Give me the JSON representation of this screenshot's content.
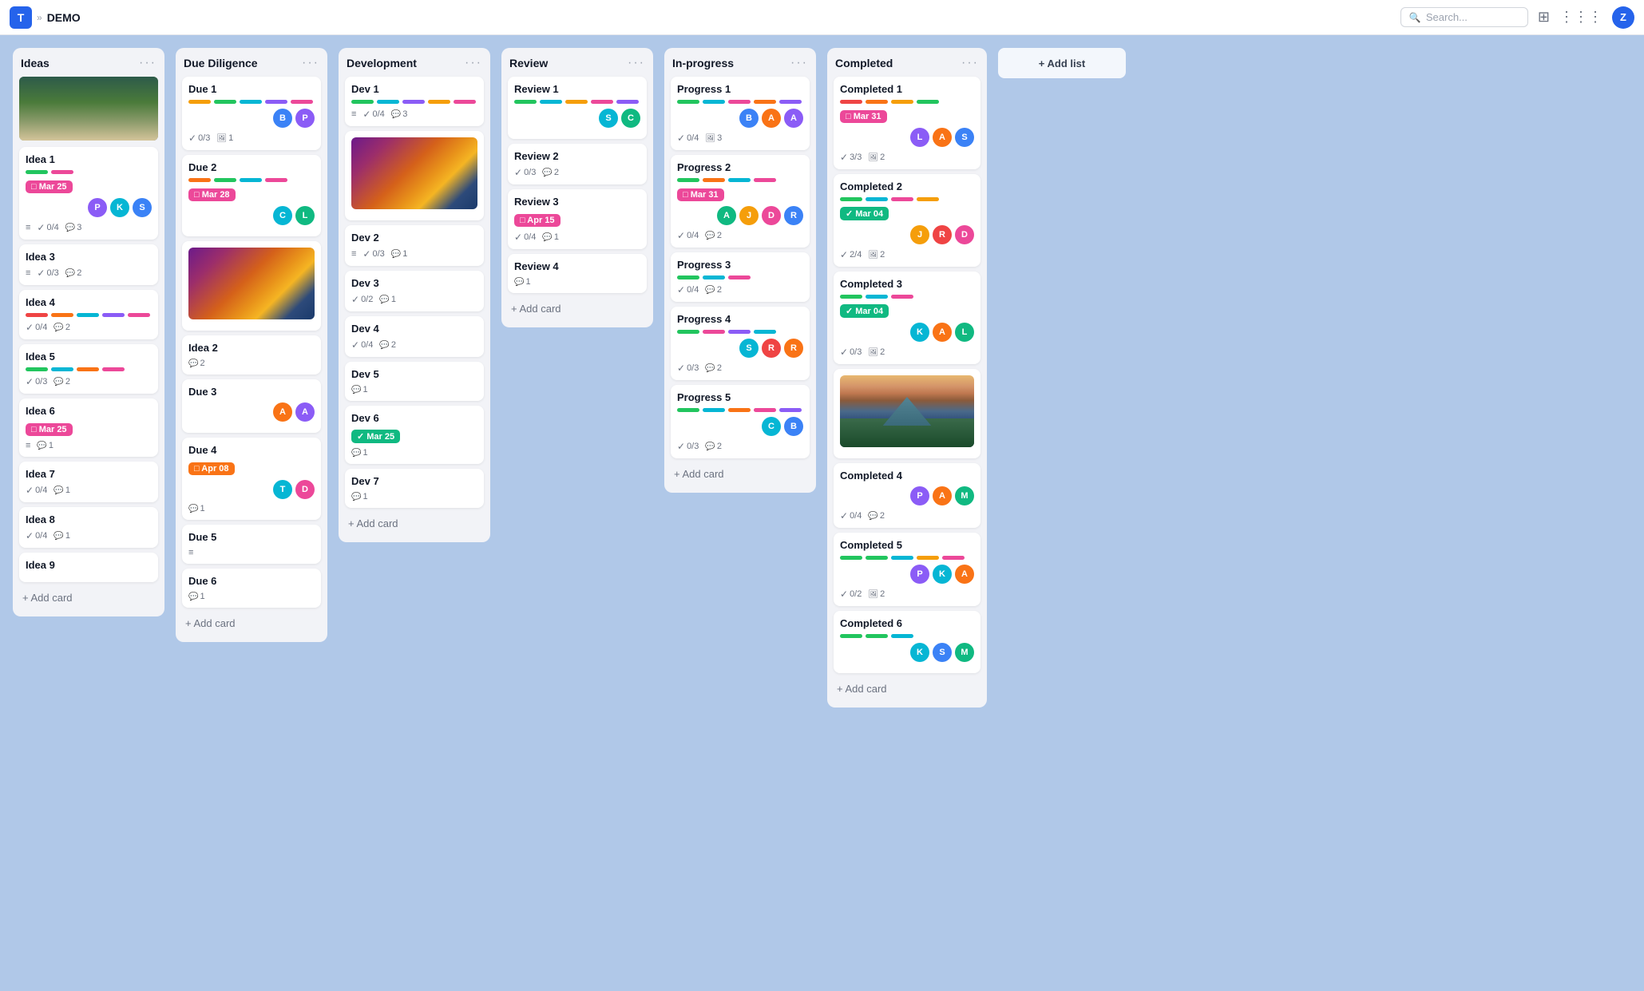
{
  "topbar": {
    "logo": "T",
    "breadcrumb": "»",
    "title": "DEMO",
    "search_placeholder": "Search...",
    "avatar": "Z"
  },
  "columns": [
    {
      "id": "ideas",
      "title": "Ideas",
      "has_image": true,
      "cards": [
        {
          "id": "idea1",
          "title": "Idea 1",
          "tags": [
            "#22c55e",
            "#ec4899"
          ],
          "date": {
            "label": "Mar 25",
            "type": "pink"
          },
          "avatars": [
            {
              "label": "P",
              "color": "#8b5cf6"
            },
            {
              "label": "K",
              "color": "#06b6d4"
            },
            {
              "label": "S",
              "color": "#3b82f6"
            }
          ],
          "footer": {
            "list": true,
            "check": "0/4",
            "msg": "3"
          }
        },
        {
          "id": "idea3",
          "title": "Idea 3",
          "tags": [],
          "footer": {
            "list": true,
            "check": "0/3",
            "msg": "2"
          }
        },
        {
          "id": "idea4",
          "title": "Idea 4",
          "tags": [
            "#ef4444",
            "#f97316",
            "#06b6d4",
            "#8b5cf6",
            "#ec4899"
          ],
          "footer": {
            "list": false,
            "check": "0/4",
            "msg": "2"
          }
        },
        {
          "id": "idea5",
          "title": "Idea 5",
          "tags": [
            "#22c55e",
            "#06b6d4",
            "#f97316",
            "#ec4899"
          ],
          "footer": {
            "list": false,
            "check": "0/3",
            "msg": "2"
          }
        },
        {
          "id": "idea6",
          "title": "Idea 6",
          "date": {
            "label": "Mar 25",
            "type": "pink"
          },
          "footer": {
            "list": true,
            "msg": "1"
          }
        },
        {
          "id": "idea7",
          "title": "Idea 7",
          "footer": {
            "list": false,
            "check": "0/4",
            "msg": "1"
          }
        },
        {
          "id": "idea8",
          "title": "Idea 8",
          "footer": {
            "list": false,
            "check": "0/4",
            "msg": "1"
          }
        },
        {
          "id": "idea9",
          "title": "Idea 9",
          "footer": {}
        }
      ],
      "add_card": "+ Add card"
    },
    {
      "id": "due",
      "title": "Due Diligence",
      "cards": [
        {
          "id": "due1",
          "title": "Due 1",
          "tags": [
            "#f59e0b",
            "#22c55e",
            "#06b6d4",
            "#8b5cf6",
            "#ec4899"
          ],
          "avatars": [
            {
              "label": "B",
              "color": "#3b82f6"
            },
            {
              "label": "P",
              "color": "#8b5cf6"
            }
          ],
          "footer": {
            "list": false,
            "check": "0/3",
            "img": "1"
          }
        },
        {
          "id": "due2",
          "title": "Due 2",
          "tags": [
            "#f97316",
            "#22c55e",
            "#06b6d4",
            "#ec4899"
          ],
          "date": {
            "label": "Mar 28",
            "type": "pink"
          },
          "avatars": [
            {
              "label": "C",
              "color": "#06b6d4"
            },
            {
              "label": "L",
              "color": "#10b981"
            }
          ],
          "footer": {}
        },
        {
          "id": "idea2-img",
          "title": "",
          "has_thumbnail": "sunset",
          "footer": {}
        },
        {
          "id": "idea2",
          "title": "Idea 2",
          "footer": {
            "msg": "2"
          }
        },
        {
          "id": "due3",
          "title": "Due 3",
          "tags": [],
          "avatars": [
            {
              "label": "A",
              "color": "#f97316"
            },
            {
              "label": "A",
              "color": "#8b5cf6"
            }
          ],
          "footer": {}
        },
        {
          "id": "due4",
          "title": "Due 4",
          "date": {
            "label": "Apr 08",
            "type": "orange"
          },
          "avatars": [
            {
              "label": "T",
              "color": "#06b6d4"
            },
            {
              "label": "D",
              "color": "#ec4899"
            }
          ],
          "footer": {
            "msg": "1"
          }
        },
        {
          "id": "due5",
          "title": "Due 5",
          "footer": {
            "list": true
          }
        },
        {
          "id": "due6",
          "title": "Due 6",
          "footer": {
            "list": false,
            "msg": "1"
          }
        }
      ],
      "add_card": "+ Add card"
    },
    {
      "id": "dev",
      "title": "Development",
      "cards": [
        {
          "id": "dev1",
          "title": "Dev 1",
          "tags": [
            "#22c55e",
            "#06b6d4",
            "#8b5cf6",
            "#f59e0b",
            "#ec4899"
          ],
          "footer": {
            "list": true,
            "check": "0/4",
            "msg": "3"
          }
        },
        {
          "id": "dev1-img",
          "has_thumbnail": "sunset2",
          "footer": {}
        },
        {
          "id": "dev2",
          "title": "Dev 2",
          "footer": {
            "list": true,
            "check": "0/3",
            "msg": "1"
          }
        },
        {
          "id": "dev3",
          "title": "Dev 3",
          "footer": {
            "list": false,
            "check": "0/2",
            "msg": "1"
          }
        },
        {
          "id": "dev4",
          "title": "Dev 4",
          "footer": {
            "list": false,
            "check": "0/4",
            "msg": "2"
          }
        },
        {
          "id": "dev5",
          "title": "Dev 5",
          "footer": {
            "list": false,
            "msg": "1"
          }
        },
        {
          "id": "dev6",
          "title": "Dev 6",
          "date": {
            "label": "Mar 25",
            "type": "green"
          },
          "footer": {
            "list": false,
            "msg": "1"
          }
        },
        {
          "id": "dev7",
          "title": "Dev 7",
          "footer": {
            "list": false,
            "msg": "1"
          }
        }
      ],
      "add_card": "+ Add card"
    },
    {
      "id": "review",
      "title": "Review",
      "cards": [
        {
          "id": "rev1",
          "title": "Review 1",
          "tags": [
            "#22c55e",
            "#06b6d4",
            "#f59e0b",
            "#ec4899",
            "#8b5cf6"
          ],
          "avatars": [
            {
              "label": "S",
              "color": "#06b6d4"
            },
            {
              "label": "C",
              "color": "#10b981"
            }
          ],
          "footer": {}
        },
        {
          "id": "rev2",
          "title": "Review 2",
          "footer": {
            "list": false,
            "check": "0/3",
            "msg": "2"
          }
        },
        {
          "id": "rev3",
          "title": "Review 3",
          "date": {
            "label": "Apr 15",
            "type": "pink"
          },
          "footer": {
            "list": false,
            "check": "0/4",
            "msg": "1"
          }
        },
        {
          "id": "rev4",
          "title": "Review 4",
          "footer": {
            "list": false,
            "msg": "1"
          }
        }
      ],
      "add_card": "+ Add card"
    },
    {
      "id": "inprogress",
      "title": "In-progress",
      "cards": [
        {
          "id": "prog1",
          "title": "Progress 1",
          "tags": [
            "#22c55e",
            "#06b6d4",
            "#ec4899",
            "#f97316",
            "#8b5cf6"
          ],
          "avatars": [
            {
              "label": "B",
              "color": "#3b82f6"
            },
            {
              "label": "A",
              "color": "#f97316"
            },
            {
              "label": "A",
              "color": "#8b5cf6"
            }
          ],
          "footer": {
            "list": false,
            "check": "0/4",
            "img": "3"
          }
        },
        {
          "id": "prog2",
          "title": "Progress 2",
          "tags": [
            "#22c55e",
            "#f97316",
            "#06b6d4",
            "#ec4899"
          ],
          "date": {
            "label": "Mar 31",
            "type": "pink"
          },
          "avatars": [
            {
              "label": "A",
              "color": "#10b981"
            },
            {
              "label": "J",
              "color": "#f59e0b"
            },
            {
              "label": "D",
              "color": "#ec4899"
            },
            {
              "label": "R",
              "color": "#3b82f6"
            }
          ],
          "footer": {
            "list": false,
            "check": "0/4",
            "msg": "2"
          }
        },
        {
          "id": "prog3",
          "title": "Progress 3",
          "tags": [
            "#22c55e",
            "#06b6d4",
            "#ec4899"
          ],
          "footer": {
            "list": false,
            "check": "0/4",
            "msg": "2"
          }
        },
        {
          "id": "prog4",
          "title": "Progress 4",
          "tags": [
            "#22c55e",
            "#ec4899",
            "#8b5cf6",
            "#06b6d4"
          ],
          "avatars": [
            {
              "label": "S",
              "color": "#06b6d4"
            },
            {
              "label": "R",
              "color": "#ef4444"
            },
            {
              "label": "R",
              "color": "#f97316"
            }
          ],
          "footer": {
            "list": false,
            "check": "0/3",
            "msg": "2"
          }
        },
        {
          "id": "prog5",
          "title": "Progress 5",
          "tags": [
            "#22c55e",
            "#06b6d4",
            "#f97316",
            "#ec4899",
            "#8b5cf6"
          ],
          "avatars": [
            {
              "label": "C",
              "color": "#06b6d4"
            },
            {
              "label": "B",
              "color": "#3b82f6"
            }
          ],
          "footer": {
            "list": false,
            "check": "0/3",
            "msg": "2"
          }
        }
      ],
      "add_card": "+ Add card"
    },
    {
      "id": "completed",
      "title": "Completed",
      "cards": [
        {
          "id": "comp1",
          "title": "Completed 1",
          "tags": [
            "#ef4444",
            "#f97316",
            "#f59e0b",
            "#22c55e"
          ],
          "date": {
            "label": "Mar 31",
            "type": "pink"
          },
          "avatars": [
            {
              "label": "L",
              "color": "#8b5cf6"
            },
            {
              "label": "A",
              "color": "#f97316"
            },
            {
              "label": "S",
              "color": "#3b82f6"
            }
          ],
          "footer": {
            "list": false,
            "check": "3/3",
            "img": "2"
          }
        },
        {
          "id": "comp2",
          "title": "Completed 2",
          "tags": [
            "#22c55e",
            "#06b6d4",
            "#ec4899",
            "#f59e0b"
          ],
          "date": {
            "label": "Mar 04",
            "type": "green"
          },
          "avatars": [
            {
              "label": "J",
              "color": "#f59e0b"
            },
            {
              "label": "R",
              "color": "#ef4444"
            },
            {
              "label": "D",
              "color": "#ec4899"
            }
          ],
          "footer": {
            "list": false,
            "check": "2/4",
            "img": "2"
          }
        },
        {
          "id": "comp3",
          "title": "Completed 3",
          "tags": [
            "#22c55e",
            "#06b6d4",
            "#ec4899"
          ],
          "date": {
            "label": "Mar 04",
            "type": "green"
          },
          "avatars": [
            {
              "label": "K",
              "color": "#06b6d4"
            },
            {
              "label": "A",
              "color": "#f97316"
            },
            {
              "label": "L",
              "color": "#10b981"
            }
          ],
          "footer": {
            "list": false,
            "check": "0/3",
            "img": "2"
          }
        },
        {
          "id": "comp4-img",
          "has_thumbnail": "mountain",
          "footer": {}
        },
        {
          "id": "comp4",
          "title": "Completed 4",
          "avatars": [
            {
              "label": "P",
              "color": "#8b5cf6"
            },
            {
              "label": "A",
              "color": "#f97316"
            },
            {
              "label": "M",
              "color": "#10b981"
            }
          ],
          "footer": {
            "list": false,
            "check": "0/4",
            "msg": "2"
          }
        },
        {
          "id": "comp5",
          "title": "Completed 5",
          "tags": [
            "#22c55e",
            "#22c55e",
            "#06b6d4",
            "#f59e0b",
            "#ec4899"
          ],
          "avatars": [
            {
              "label": "P",
              "color": "#8b5cf6"
            },
            {
              "label": "K",
              "color": "#06b6d4"
            },
            {
              "label": "A",
              "color": "#f97316"
            }
          ],
          "footer": {
            "list": false,
            "check": "0/2",
            "img": "2"
          }
        },
        {
          "id": "comp6",
          "title": "Completed 6",
          "tags": [
            "#22c55e",
            "#22c55e",
            "#06b6d4"
          ],
          "avatars": [
            {
              "label": "K",
              "color": "#06b6d4"
            },
            {
              "label": "S",
              "color": "#3b82f6"
            },
            {
              "label": "M",
              "color": "#10b981"
            }
          ],
          "footer": {}
        }
      ],
      "add_card": "+ Add card"
    }
  ],
  "add_list": "+ Add list"
}
